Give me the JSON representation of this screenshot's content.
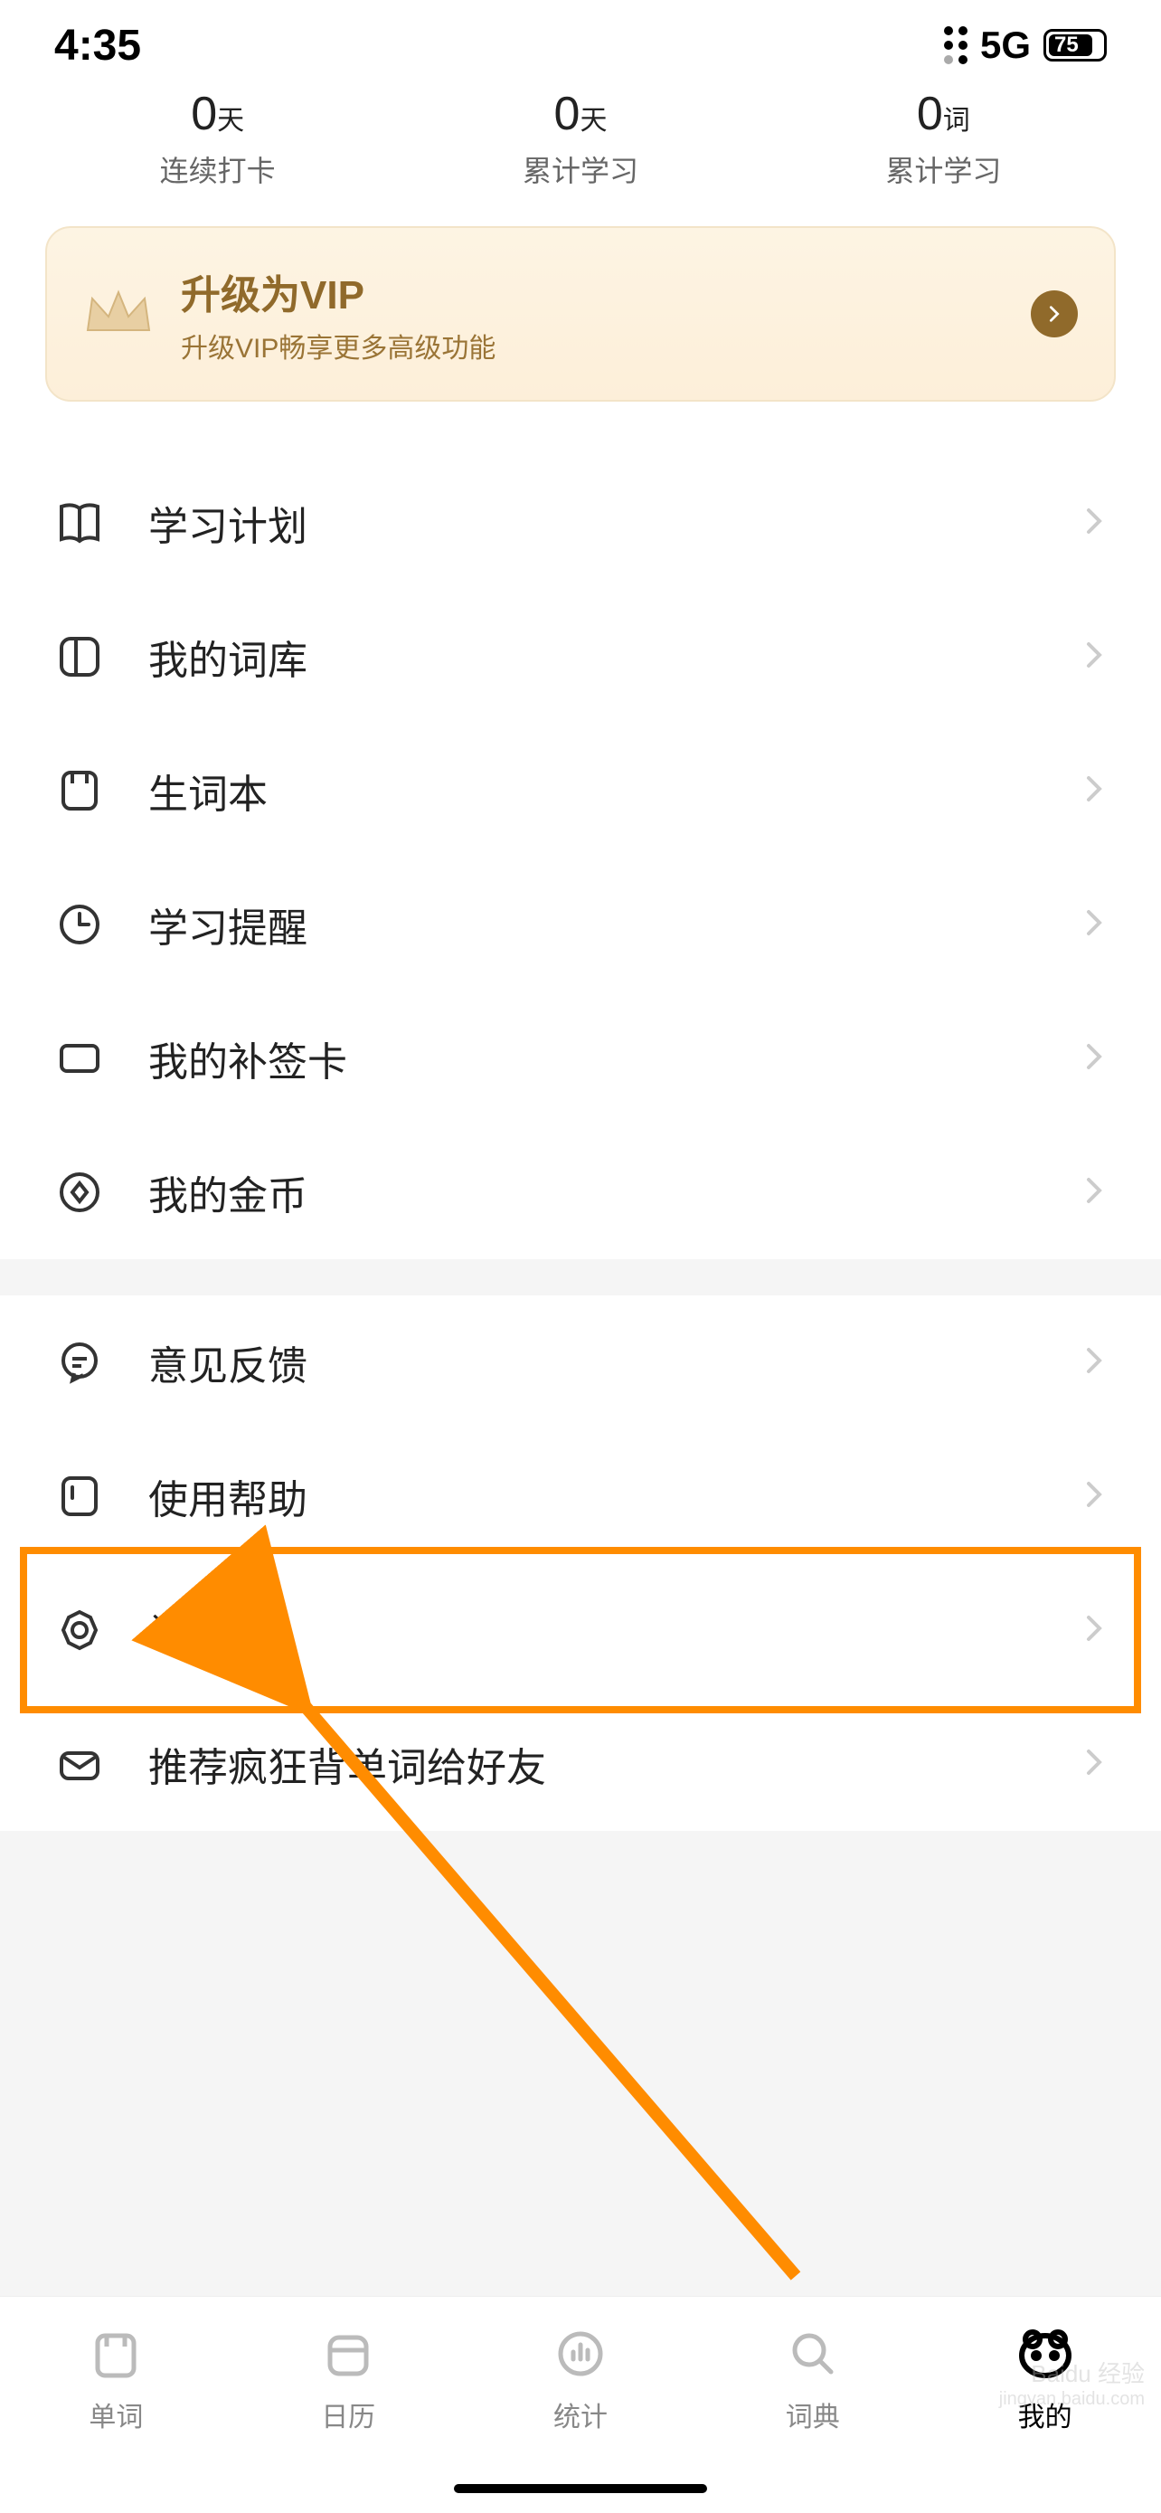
{
  "status": {
    "time": "4:35",
    "network": "5G",
    "battery": "75"
  },
  "stats": [
    {
      "value": "0",
      "unit": "天",
      "label": "连续打卡"
    },
    {
      "value": "0",
      "unit": "天",
      "label": "累计学习"
    },
    {
      "value": "0",
      "unit": "词",
      "label": "累计学习"
    }
  ],
  "vip": {
    "title": "升级为VIP",
    "subtitle": "升级VIP畅享更多高级功能"
  },
  "menu1": [
    {
      "icon": "book",
      "label": "学习计划"
    },
    {
      "icon": "split",
      "label": "我的词库"
    },
    {
      "icon": "notebook",
      "label": "生词本"
    },
    {
      "icon": "clock",
      "label": "学习提醒"
    },
    {
      "icon": "card",
      "label": "我的补签卡"
    },
    {
      "icon": "coin",
      "label": "我的金币"
    }
  ],
  "menu2": [
    {
      "icon": "chat",
      "label": "意见反馈"
    },
    {
      "icon": "help",
      "label": "使用帮助"
    },
    {
      "icon": "gear",
      "label": "设置",
      "highlighted": true
    },
    {
      "icon": "mail",
      "label": "推荐疯狂背单词给好友"
    }
  ],
  "tabs": [
    {
      "icon": "word",
      "label": "单词"
    },
    {
      "icon": "calendar",
      "label": "日历"
    },
    {
      "icon": "stats",
      "label": "统计"
    },
    {
      "icon": "dict",
      "label": "词典"
    },
    {
      "icon": "mine",
      "label": "我的",
      "active": true
    }
  ],
  "watermark": {
    "brand": "Baidu 经验",
    "url": "jingyan.baidu.com"
  }
}
